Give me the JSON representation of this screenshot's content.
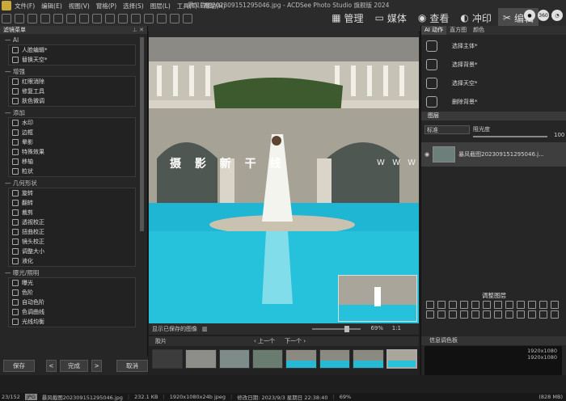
{
  "window": {
    "title": "暴风截图202309151295046.jpg - ACDSee Photo Studio 旗舰版 2024"
  },
  "menu": [
    "文件(F)",
    "编辑(E)",
    "视图(V)",
    "窗格(P)",
    "选择(S)",
    "图层(L)",
    "工具(T)",
    "帮助(H)"
  ],
  "modes": [
    {
      "icon": "grid-icon",
      "label": "管理"
    },
    {
      "icon": "media-icon",
      "label": "媒体"
    },
    {
      "icon": "eye-icon",
      "label": "查看"
    },
    {
      "icon": "develop-icon",
      "label": "冲印"
    },
    {
      "icon": "edit-icon",
      "label": "编辑",
      "active": true
    }
  ],
  "left_panel": {
    "title": "滤镜菜单",
    "sections": [
      {
        "title": "AI",
        "items": [
          "人脸编辑*",
          "替换天空*"
        ]
      },
      {
        "title": "增强",
        "items": [
          "红眼消除",
          "修复工具",
          "肤色微调"
        ]
      },
      {
        "title": "添加",
        "items": [
          "水印",
          "边框",
          "晕影",
          "特殊效果",
          "移轴",
          "粒状"
        ]
      },
      {
        "title": "几何形状",
        "items": [
          "旋转",
          "翻转",
          "裁剪",
          "透视校正",
          "扭曲校正",
          "镜头校正",
          "调整大小",
          "液化"
        ]
      },
      {
        "title": "曝光/照明",
        "items": [
          "曝光",
          "色阶",
          "自动色阶",
          "色调曲线",
          "光线均衡"
        ]
      }
    ],
    "footer": {
      "save": "保存",
      "done": "完成",
      "cancel": "取消"
    }
  },
  "center": {
    "watermark_cn": "摄 影 新 干 线",
    "watermark_en": "W W W . P H O T O S 4 S . V I P",
    "show_saved_label": "显示已保存的图像",
    "zoom": "69%",
    "zoom_ratio": "1:1"
  },
  "filmstrip": {
    "title": "胶片",
    "prev": "上一个",
    "next": "下一个"
  },
  "right_panel": {
    "tabs": [
      "AI 动作",
      "直方图",
      "颜色"
    ],
    "ai_actions": [
      "选择主体*",
      "选择背景*",
      "选择天空*",
      "删除背景*"
    ],
    "layers_title": "图层",
    "blend_mode": "标准",
    "opacity_label": "阻光度",
    "opacity_value": "100",
    "layer_name": "暴风截图202309151295046.j...",
    "adjust_title": "调整图层",
    "histogram_title": "信息调色板",
    "hist_w": "1920x1080",
    "hist_h": "1920x1080"
  },
  "status": {
    "index": "23/152",
    "type": "JPG",
    "filename": "暴风截图202309151295046.jpg",
    "size": "232.1 KB",
    "dims": "1920x1080x24b jpeg",
    "modified": "修改日期: 2023/9/3 星期日 22:38:40",
    "zoom": "69%",
    "extra": "(828 MB)"
  }
}
